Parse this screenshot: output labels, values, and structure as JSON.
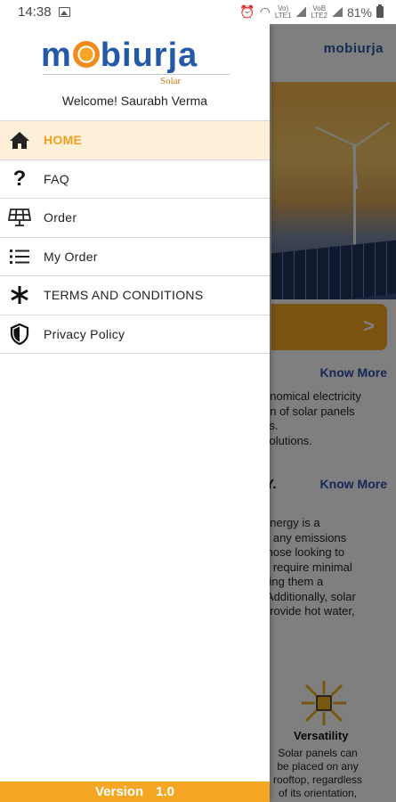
{
  "status_bar": {
    "time": "14:38",
    "lte_label": "Vo)\nLTE1",
    "volte_label": "VoB\nLTE2",
    "battery_percent": "81%"
  },
  "app": {
    "header_logo": "mobiurja",
    "know_more_1": "Know More",
    "know_more_2": "Know More",
    "cta_arrow": ">",
    "intro_text": "onomical electricity\non of solar panels\nss.\nsolutions.",
    "section_heading": "Y.",
    "energy_text": "energy is a\ne any emissions\nthose looking to\no require minimal\nking them a\n Additionally, solar\nprovide hot water,",
    "versatility_title": "Versatility",
    "versatility_text": "Solar panels can\nbe placed on any\nrooftop, regardless\nof its orientation,"
  },
  "drawer": {
    "brand_name": "mobiurja",
    "brand_sub": "Solar",
    "welcome_text": "Welcome! Saurabh Verma",
    "accent_color": "#f5a623",
    "items": [
      {
        "label": "HOME",
        "icon": "home-icon",
        "active": true
      },
      {
        "label": "FAQ",
        "icon": "question-icon",
        "active": false
      },
      {
        "label": "Order",
        "icon": "solar-panel-icon",
        "active": false
      },
      {
        "label": "My Order",
        "icon": "list-icon",
        "active": false
      },
      {
        "label": "TERMS AND CONDITIONS",
        "icon": "asterisk-icon",
        "active": false
      },
      {
        "label": "Privacy Policy",
        "icon": "shield-icon",
        "active": false
      }
    ],
    "version_label": "Version",
    "version_number": "1.0"
  }
}
